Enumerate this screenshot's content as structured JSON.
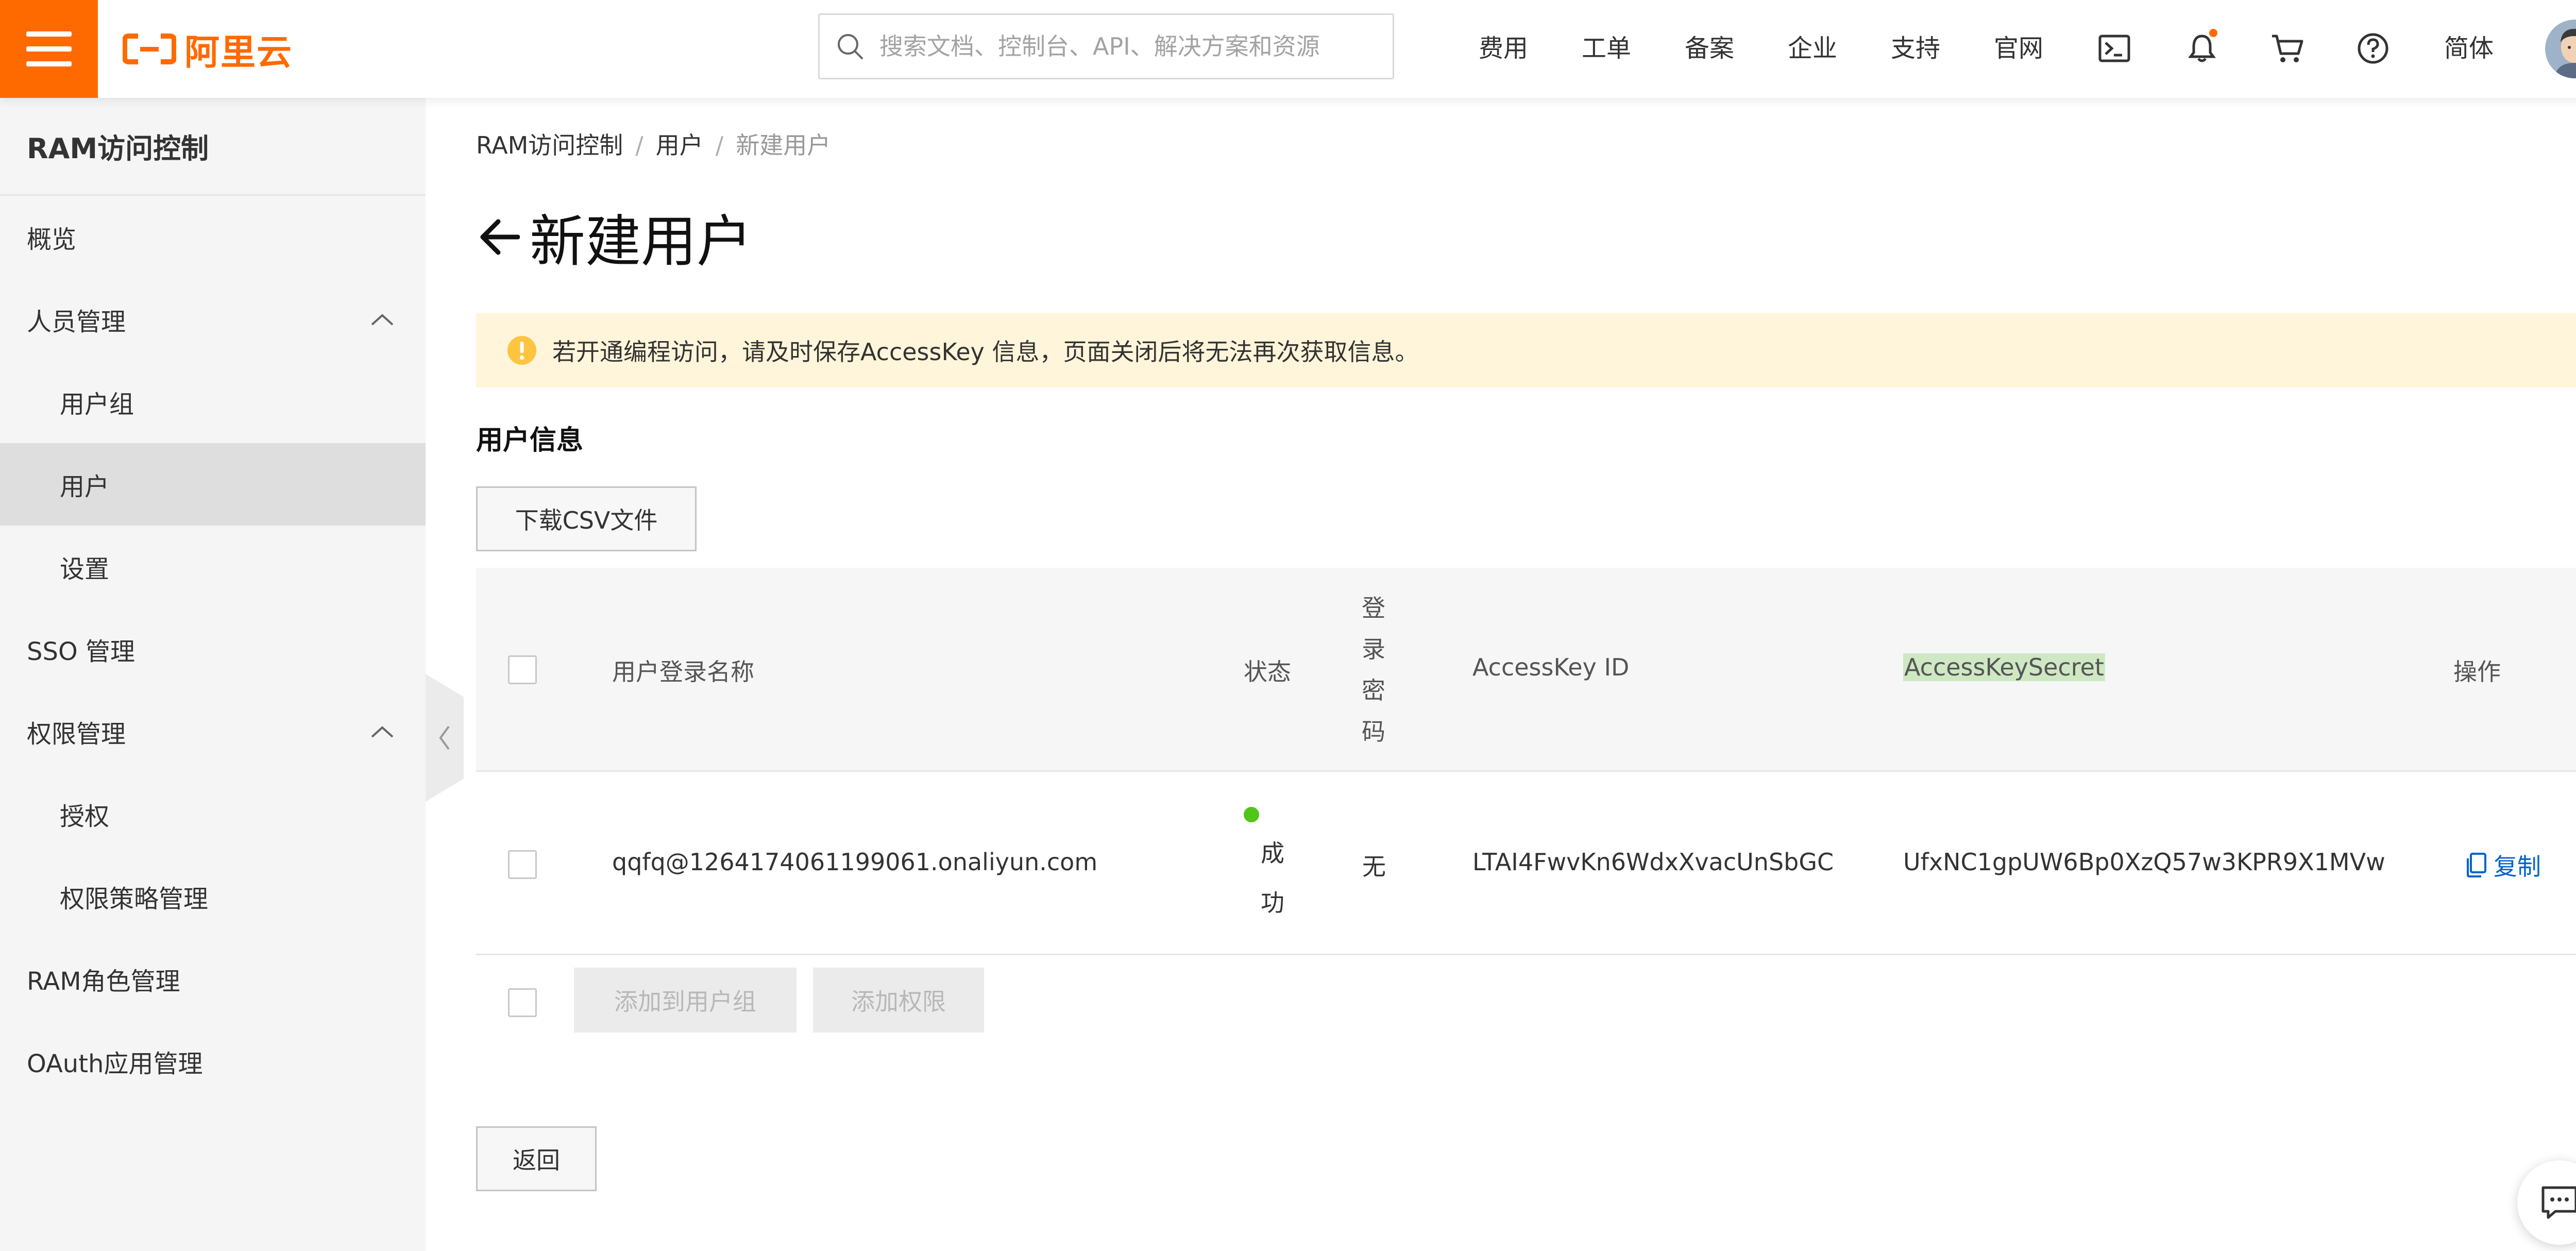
{
  "header": {
    "brand": "阿里云",
    "search_placeholder": "搜索文档、控制台、API、解决方案和资源",
    "nav": [
      "费用",
      "工单",
      "备案",
      "企业",
      "支持",
      "官网"
    ],
    "lang": "简体",
    "notification_dot_color": "#ff6a00",
    "accent_color": "#ff6a00"
  },
  "sidebar": {
    "title": "RAM访问控制",
    "items": [
      {
        "label": "概览"
      },
      {
        "label": "人员管理"
      },
      {
        "label": "用户组"
      },
      {
        "label": "用户"
      },
      {
        "label": "设置"
      },
      {
        "label": "SSO 管理"
      },
      {
        "label": "权限管理"
      },
      {
        "label": "授权"
      },
      {
        "label": "权限策略管理"
      },
      {
        "label": "RAM角色管理"
      },
      {
        "label": "OAuth应用管理"
      }
    ],
    "active_item": "用户"
  },
  "breadcrumb": [
    "RAM访问控制",
    "用户",
    "新建用户"
  ],
  "page": {
    "title": "新建用户",
    "alert": "若开通编程访问，请及时保存AccessKey 信息，页面关闭后将无法再次获取信息。",
    "section_title": "用户信息",
    "download_button": "下载CSV文件"
  },
  "table": {
    "headers": {
      "login_name": "用户登录名称",
      "status": "状态",
      "login_password": [
        "登",
        "录",
        "密",
        "码"
      ],
      "access_key_id": "AccessKey ID",
      "access_key_secret": "AccessKeySecret",
      "actions": "操作"
    },
    "rows": [
      {
        "login_name": "qqfq@1264174061199061.onaliyun.com",
        "status": [
          "成",
          "功"
        ],
        "status_color": "#52c41a",
        "login_password": "无",
        "access_key_id": "LTAI4FwvKn6WdxXvacUnSbGC",
        "access_key_secret": "UfxNC1gpUW6Bp0XzQ57w3KPR9X1MVw",
        "action": "复制"
      }
    ],
    "batch_actions": [
      "添加到用户组",
      "添加权限"
    ]
  },
  "footer": {
    "back_button": "返回"
  }
}
